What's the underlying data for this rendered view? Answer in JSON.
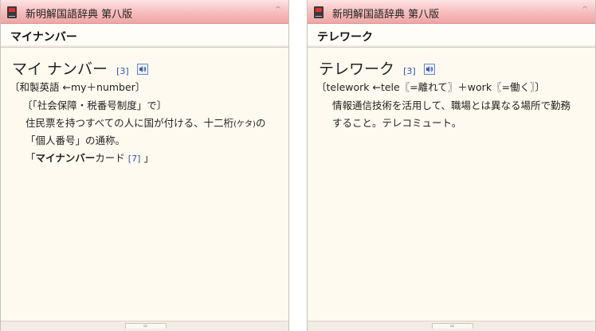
{
  "app": {
    "title": "新明解国語辞典 第八版",
    "collapse_glyph": "^"
  },
  "left": {
    "headword": "マイナンバー",
    "entry_word": "マイ ナンバー",
    "ref": "[3]",
    "etymology": "〔和製英語 ←my＋number〕",
    "note": "〔「社会保障・税番号制度」で〕",
    "def_line1_a": "住民票を持つすべての人に国が付ける、十二桁",
    "def_line1_reading": "(ケタ)",
    "def_line1_b": "の",
    "def_line2": "「個人番号」の通称。",
    "example_open": "「",
    "example_bold": "マイナンバー",
    "example_rest": "カード",
    "example_ref": "[7]",
    "example_close": "」"
  },
  "right": {
    "headword": "テレワーク",
    "entry_word": "テレワーク",
    "ref": "[3]",
    "etymology": "〔telework ←tele〖=離れて〗＋work〖=働く〗〕",
    "def_line1": "情報通信技術を活用して、職場とは異なる場所で勤務",
    "def_line2": "すること。テレコミュート。"
  },
  "grip_glyph": "="
}
